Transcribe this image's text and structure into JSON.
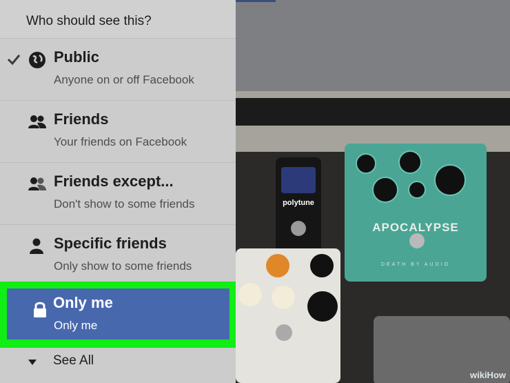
{
  "menu": {
    "header": "Who should see this?",
    "options": [
      {
        "label": "Public",
        "description": "Anyone on or off Facebook",
        "icon": "globe-icon",
        "checked": true
      },
      {
        "label": "Friends",
        "description": "Your friends on Facebook",
        "icon": "friends-icon",
        "checked": false
      },
      {
        "label": "Friends except...",
        "description": "Don't show to some friends",
        "icon": "friends-except-icon",
        "checked": false
      },
      {
        "label": "Specific friends",
        "description": "Only show to some friends",
        "icon": "person-icon",
        "checked": false
      },
      {
        "label": "Only me",
        "description": "Only me",
        "icon": "lock-icon",
        "checked": false,
        "highlighted": true
      }
    ],
    "see_all": "See All"
  },
  "photo": {
    "pedal_brand": "polytune",
    "pedal_name": "APOCALYPSE",
    "pedal_sub": "DEATH BY AUDIO",
    "watermark": "wikiHow"
  },
  "colors": {
    "highlight_border": "#10ee16",
    "selected_bg": "#4868ae",
    "menu_bg": "#cccccc"
  }
}
